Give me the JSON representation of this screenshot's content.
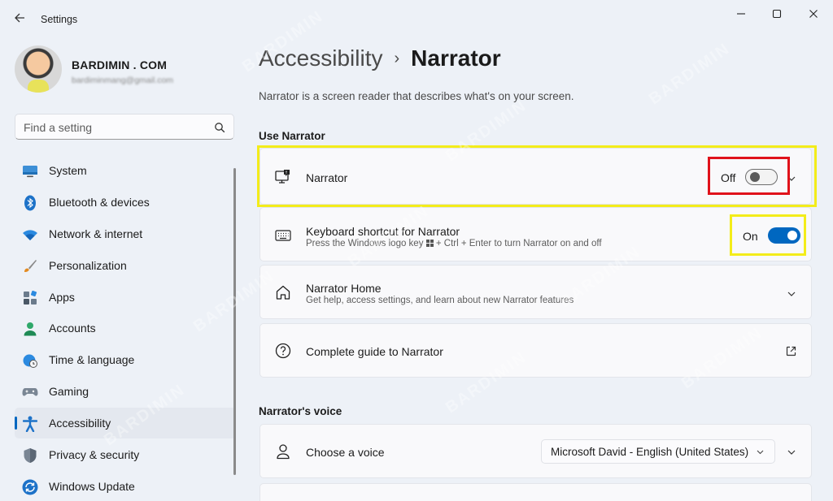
{
  "window": {
    "title": "Settings"
  },
  "profile": {
    "name": "BARDIMIN . COM",
    "email": "bardiminmang@gmail.com"
  },
  "search": {
    "placeholder": "Find a setting"
  },
  "sidebar": {
    "items": [
      {
        "label": "System",
        "icon": "system-icon",
        "active": false
      },
      {
        "label": "Bluetooth & devices",
        "icon": "bluetooth-icon",
        "active": false
      },
      {
        "label": "Network & internet",
        "icon": "wifi-icon",
        "active": false
      },
      {
        "label": "Personalization",
        "icon": "brush-icon",
        "active": false
      },
      {
        "label": "Apps",
        "icon": "apps-icon",
        "active": false
      },
      {
        "label": "Accounts",
        "icon": "accounts-icon",
        "active": false
      },
      {
        "label": "Time & language",
        "icon": "globe-clock-icon",
        "active": false
      },
      {
        "label": "Gaming",
        "icon": "gamepad-icon",
        "active": false
      },
      {
        "label": "Accessibility",
        "icon": "accessibility-icon",
        "active": true
      },
      {
        "label": "Privacy & security",
        "icon": "shield-icon",
        "active": false
      },
      {
        "label": "Windows Update",
        "icon": "update-icon",
        "active": false
      }
    ]
  },
  "main": {
    "breadcrumb_parent": "Accessibility",
    "breadcrumb_separator": "›",
    "page_title": "Narrator",
    "description": "Narrator is a screen reader that describes what's on your screen.",
    "section_use": "Use Narrator",
    "narrator_row": {
      "title": "Narrator",
      "state_label": "Off",
      "enabled": false
    },
    "shortcut_row": {
      "title": "Keyboard shortcut for Narrator",
      "subtitle_before": "Press the Windows logo key",
      "subtitle_after": "+ Ctrl + Enter to turn Narrator on and off",
      "state_label": "On",
      "enabled": true
    },
    "home_row": {
      "title": "Narrator Home",
      "subtitle": "Get help, access settings, and learn about new Narrator features"
    },
    "guide_row": {
      "title": "Complete guide to Narrator"
    },
    "section_voice": "Narrator's voice",
    "voice_row": {
      "title": "Choose a voice",
      "selected_voice": "Microsoft David - English (United States)"
    }
  },
  "colors": {
    "accent": "#0067c0",
    "highlight_yellow": "#f3ec1a",
    "highlight_red": "#e0121b",
    "background": "#edf1f7"
  },
  "watermark": "BARDIMIN"
}
